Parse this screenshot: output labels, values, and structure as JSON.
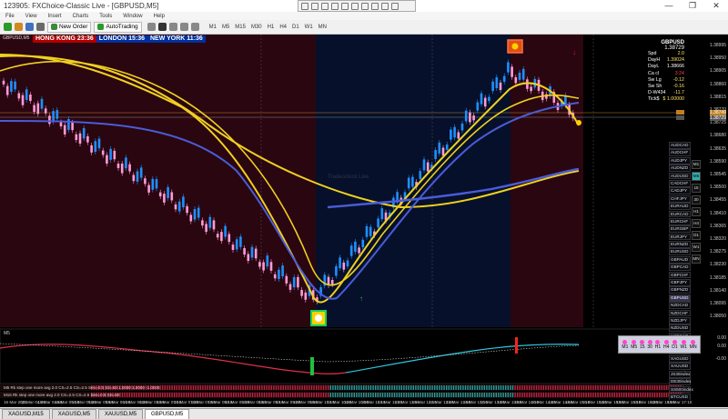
{
  "window": {
    "title": "123905: FXChoice-Classic Live - [GBPUSD,M5]",
    "controls": [
      "—",
      "❐",
      "✕"
    ]
  },
  "menu": [
    "File",
    "View",
    "Insert",
    "Charts",
    "Tools",
    "Window",
    "Help"
  ],
  "toolbar": {
    "new_order": "New Order",
    "autotrading": "AutoTrading",
    "timeframes": [
      "M1",
      "M5",
      "M15",
      "M30",
      "H1",
      "H4",
      "D1",
      "W1",
      "MN"
    ]
  },
  "chart": {
    "symbol_label": "GBPUSD,M5",
    "sessions": {
      "hong_kong": "HONG KONG 23:36",
      "london": "LONDON 15:36",
      "new_york": "NEW YORK 11:36"
    },
    "watermark": "Tradeoclock Live",
    "price_ticks": [
      "1.38995",
      "1.38950",
      "1.38905",
      "1.38860",
      "1.38815",
      "1.38770",
      "1.38725",
      "1.38680",
      "1.38635",
      "1.38590",
      "1.38545",
      "1.38500",
      "1.38455",
      "1.38410",
      "1.38365",
      "1.38320",
      "1.38275",
      "1.38230",
      "1.38185",
      "1.38140",
      "1.38095",
      "1.38050"
    ],
    "price_markers": {
      "line1": "1.38749",
      "line2": "1.38729"
    },
    "colors": {
      "bull": "#1e90ff",
      "bear": "#ff9ad5",
      "ma_yellow": "#f0d020",
      "ma_blue": "#4a5cd8",
      "session_red": "#2a0610",
      "session_blue": "#06102a"
    }
  },
  "info_panel": {
    "symbol": "GBPUSD",
    "price": "1.38729",
    "rows": [
      {
        "k": "Spd",
        "v": "2.0"
      },
      {
        "k": "DayH",
        "v": "1.39024"
      },
      {
        "k": "DayL",
        "v": "1.38666"
      },
      {
        "k": "Ca cl",
        "v": "3:24"
      },
      {
        "k": "Sw Lg",
        "v": "-0.12"
      },
      {
        "k": "Sw Sh",
        "v": "-0.16"
      },
      {
        "k": "D-W434",
        "v": "-11.7"
      },
      {
        "k": "Tick$",
        "v": "$ 1.00000"
      }
    ]
  },
  "pairs": [
    "AUDCAD",
    "AUDCHF",
    "AUDJPY",
    "AUDNZD",
    "AUDUSD",
    "CADCHF",
    "CADJPY",
    "CHFJPY",
    "EURAUD",
    "EURCAD",
    "EURCHF",
    "EURGBP",
    "EURJPY",
    "EURNZD",
    "EURUSD",
    "GBPAUD",
    "GBPCAD",
    "GBPCHF",
    "GBPJPY",
    "GBPNZD",
    "GBPUSD",
    "NZDCAD",
    "NZDCHF",
    "NZDJPY",
    "NZDUSD",
    "USDCAD",
    "USDCHF",
    "USDJPY",
    "XAGUSD",
    "XAUUSD",
    "JS30index",
    "DE30index",
    "SS500index",
    "BTCUSD"
  ],
  "active_pair": "GBPUSD",
  "tf_list": [
    "M1",
    "M5",
    "15",
    "30",
    "H1",
    "H4",
    "D1",
    "W1",
    "MN"
  ],
  "indicator": {
    "label": "M5",
    "tf_box": [
      "M1",
      "M5",
      "15",
      "30",
      "H1",
      "H4",
      "D1",
      "W1",
      "MN"
    ],
    "axis": [
      "0.00",
      "0.00",
      "-0.00"
    ],
    "strip1": "M5 Rk step one more avg 2.0  CS=2.5  CS=2.5  Sen=0.5  SS=60  1.0000  1.0000  -1.0000",
    "strip2": "M15 Rk step one more avg 2.0  CS=2.5  CS=2.5  Sen=0.5  SS=60"
  },
  "time_ticks": [
    "16 Mar 2021",
    "16 Mar 04:30",
    "16 Mar 04:50",
    "16 Mar 05:10",
    "16 Mar 05:30",
    "16 Mar 05:50",
    "16 Mar 06:10",
    "16 Mar 06:30",
    "16 Mar 06:50",
    "16 Mar 07:10",
    "16 Mar 07:30",
    "16 Mar 07:50",
    "16 Mar 08:10",
    "16 Mar 08:30",
    "16 Mar 08:50",
    "16 Mar 09:10",
    "16 Mar 09:30",
    "16 Mar 09:50",
    "16 Mar 10:10",
    "16 Mar 10:30",
    "16 Mar 10:50",
    "16 Mar 11:10",
    "16 Mar 11:30",
    "16 Mar 11:50",
    "16 Mar 12:10",
    "16 Mar 12:30",
    "16 Mar 12:50",
    "16 Mar 13:10",
    "16 Mar 13:30",
    "16 Mar 13:50",
    "16 Mar 14:10",
    "16 Mar 14:30",
    "16 Mar 14:50",
    "16 Mar 15:10",
    "16 Mar 15:30",
    "16 Mar 15:50",
    "16 Mar 16:10",
    "16 Mar 16:30",
    "16 Mar 16:50",
    "16 Mar 17:10"
  ],
  "tabs": [
    "XAGUSD,M15",
    "XAGUSD,M5",
    "XAUUSD,M5",
    "GBPUSD,M5"
  ],
  "active_tab": "GBPUSD,M5"
}
